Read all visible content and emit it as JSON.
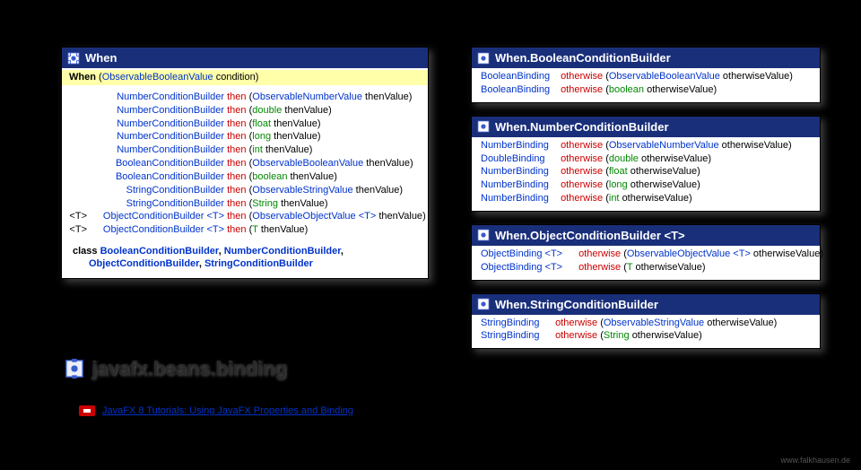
{
  "package": "javafx.beans.binding",
  "tutorial": "JavaFX 8 Tutorials: Using JavaFX Properties and Binding",
  "watermark": "www.falkhausen.de",
  "when": {
    "title": "When",
    "ctor_name": "When",
    "ctor_param_type": "ObservableBooleanValue",
    "ctor_param_name": "condition",
    "rows": [
      {
        "ret": "NumberConditionBuilder",
        "m": "then",
        "ptype": "ObservableNumberValue",
        "pname": "thenValue",
        "link": true
      },
      {
        "ret": "NumberConditionBuilder",
        "m": "then",
        "ptype": "double",
        "pname": "thenValue",
        "link": false
      },
      {
        "ret": "NumberConditionBuilder",
        "m": "then",
        "ptype": "float",
        "pname": "thenValue",
        "link": false
      },
      {
        "ret": "NumberConditionBuilder",
        "m": "then",
        "ptype": "long",
        "pname": "thenValue",
        "link": false
      },
      {
        "ret": "NumberConditionBuilder",
        "m": "then",
        "ptype": "int",
        "pname": "thenValue",
        "link": false
      },
      {
        "ret": "BooleanConditionBuilder",
        "m": "then",
        "ptype": "ObservableBooleanValue",
        "pname": "thenValue",
        "link": true
      },
      {
        "ret": "BooleanConditionBuilder",
        "m": "then",
        "ptype": "boolean",
        "pname": "thenValue",
        "link": false
      },
      {
        "ret": "StringConditionBuilder",
        "m": "then",
        "ptype": "ObservableStringValue",
        "pname": "thenValue",
        "link": true
      },
      {
        "ret": "StringConditionBuilder",
        "m": "then",
        "ptype": "String",
        "pname": "thenValue",
        "link": false
      },
      {
        "prefix": "<T>",
        "ret": "ObjectConditionBuilder <T>",
        "m": "then",
        "ptype": "ObservableObjectValue <T>",
        "pname": "thenValue",
        "link": true
      },
      {
        "prefix": "<T>",
        "ret": "ObjectConditionBuilder <T>",
        "m": "then",
        "ptype": "T",
        "pname": "thenValue",
        "link": false
      }
    ],
    "nested_label": "class",
    "nested1": "BooleanConditionBuilder",
    "nested2": "NumberConditionBuilder",
    "nested3": "ObjectConditionBuilder",
    "nested4": "StringConditionBuilder"
  },
  "bool": {
    "title": "When.BooleanConditionBuilder",
    "rows": [
      {
        "ret": "BooleanBinding",
        "m": "otherwise",
        "ptype": "ObservableBooleanValue",
        "pname": "otherwiseValue",
        "link": true
      },
      {
        "ret": "BooleanBinding",
        "m": "otherwise",
        "ptype": "boolean",
        "pname": "otherwiseValue",
        "link": false
      }
    ]
  },
  "num": {
    "title": "When.NumberConditionBuilder",
    "rows": [
      {
        "ret": "NumberBinding",
        "m": "otherwise",
        "ptype": "ObservableNumberValue",
        "pname": "otherwiseValue",
        "link": true
      },
      {
        "ret": "DoubleBinding",
        "m": "otherwise",
        "ptype": "double",
        "pname": "otherwiseValue",
        "link": false
      },
      {
        "ret": "NumberBinding",
        "m": "otherwise",
        "ptype": "float",
        "pname": "otherwiseValue",
        "link": false
      },
      {
        "ret": "NumberBinding",
        "m": "otherwise",
        "ptype": "long",
        "pname": "otherwiseValue",
        "link": false
      },
      {
        "ret": "NumberBinding",
        "m": "otherwise",
        "ptype": "int",
        "pname": "otherwiseValue",
        "link": false
      }
    ]
  },
  "obj": {
    "title": "When.ObjectConditionBuilder <T>",
    "rows": [
      {
        "ret": "ObjectBinding <T>",
        "m": "otherwise",
        "ptype": "ObservableObjectValue <T>",
        "pname": "otherwiseValue",
        "link": true
      },
      {
        "ret": "ObjectBinding <T>",
        "m": "otherwise",
        "ptype": "T",
        "pname": "otherwiseValue",
        "link": false
      }
    ]
  },
  "str": {
    "title": "When.StringConditionBuilder",
    "rows": [
      {
        "ret": "StringBinding",
        "m": "otherwise",
        "ptype": "ObservableStringValue",
        "pname": "otherwiseValue",
        "link": true
      },
      {
        "ret": "StringBinding",
        "m": "otherwise",
        "ptype": "String",
        "pname": "otherwiseValue",
        "link": false
      }
    ]
  }
}
